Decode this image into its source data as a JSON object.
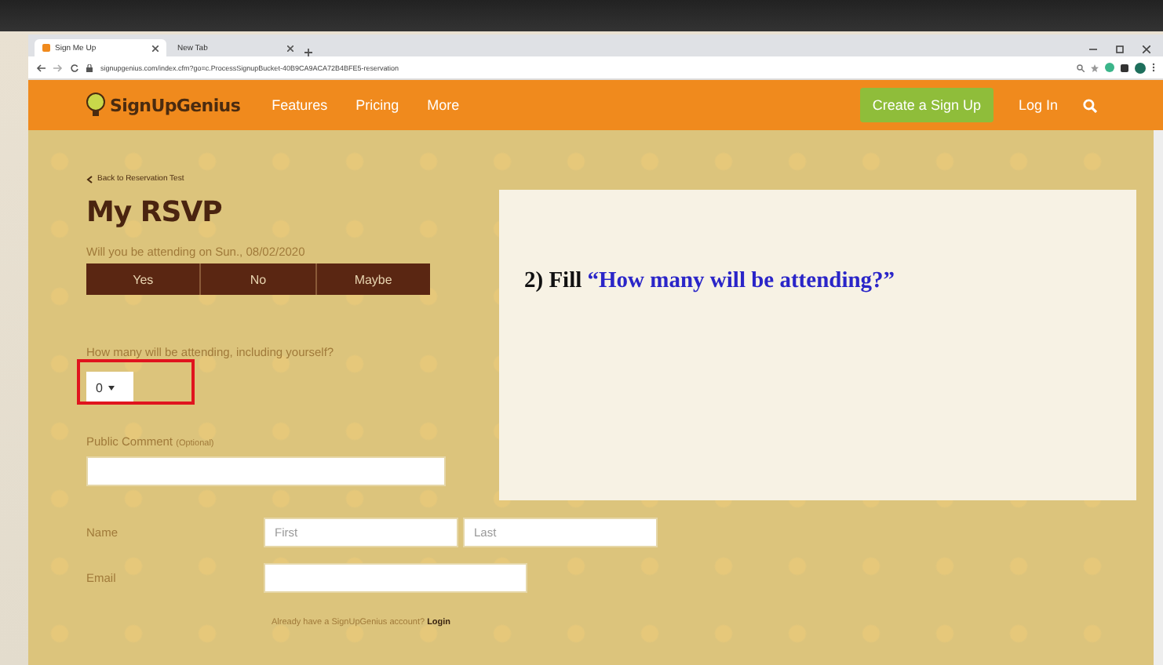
{
  "browser": {
    "tabs": [
      {
        "title": "Sign Me Up",
        "selected": true
      },
      {
        "title": "New Tab",
        "selected": false
      }
    ],
    "address": "signupgenius.com/index.cfm?go=c.ProcessSignupBucket-40B9CA9ACA72B4BFE5-reservation"
  },
  "nav": {
    "logo": "SignUpGenius",
    "links": [
      "Features",
      "Pricing",
      "More"
    ],
    "cta": "Create a Sign Up",
    "login": "Log In"
  },
  "form": {
    "back": "Back to Reservation Test",
    "title": "My RSVP",
    "question": "Will you be attending on Sun., 08/02/2020",
    "answers": [
      {
        "label": "Yes",
        "selected": false
      },
      {
        "label": "No",
        "selected": false
      },
      {
        "label": "Maybe",
        "selected": false
      }
    ],
    "count_label": "How many will be attending, including yourself?",
    "count_value": "0",
    "comment_label": "Public Comment",
    "comment_hint": "(Optional)",
    "name_label": "Name",
    "first_placeholder": "First",
    "last_placeholder": "Last",
    "email_label": "Email",
    "account_text": "Already have a SignUpGenius account?",
    "account_link": "Login"
  },
  "note": {
    "prefix": "2) Fill ",
    "quote": "“How many will be attending?”"
  }
}
